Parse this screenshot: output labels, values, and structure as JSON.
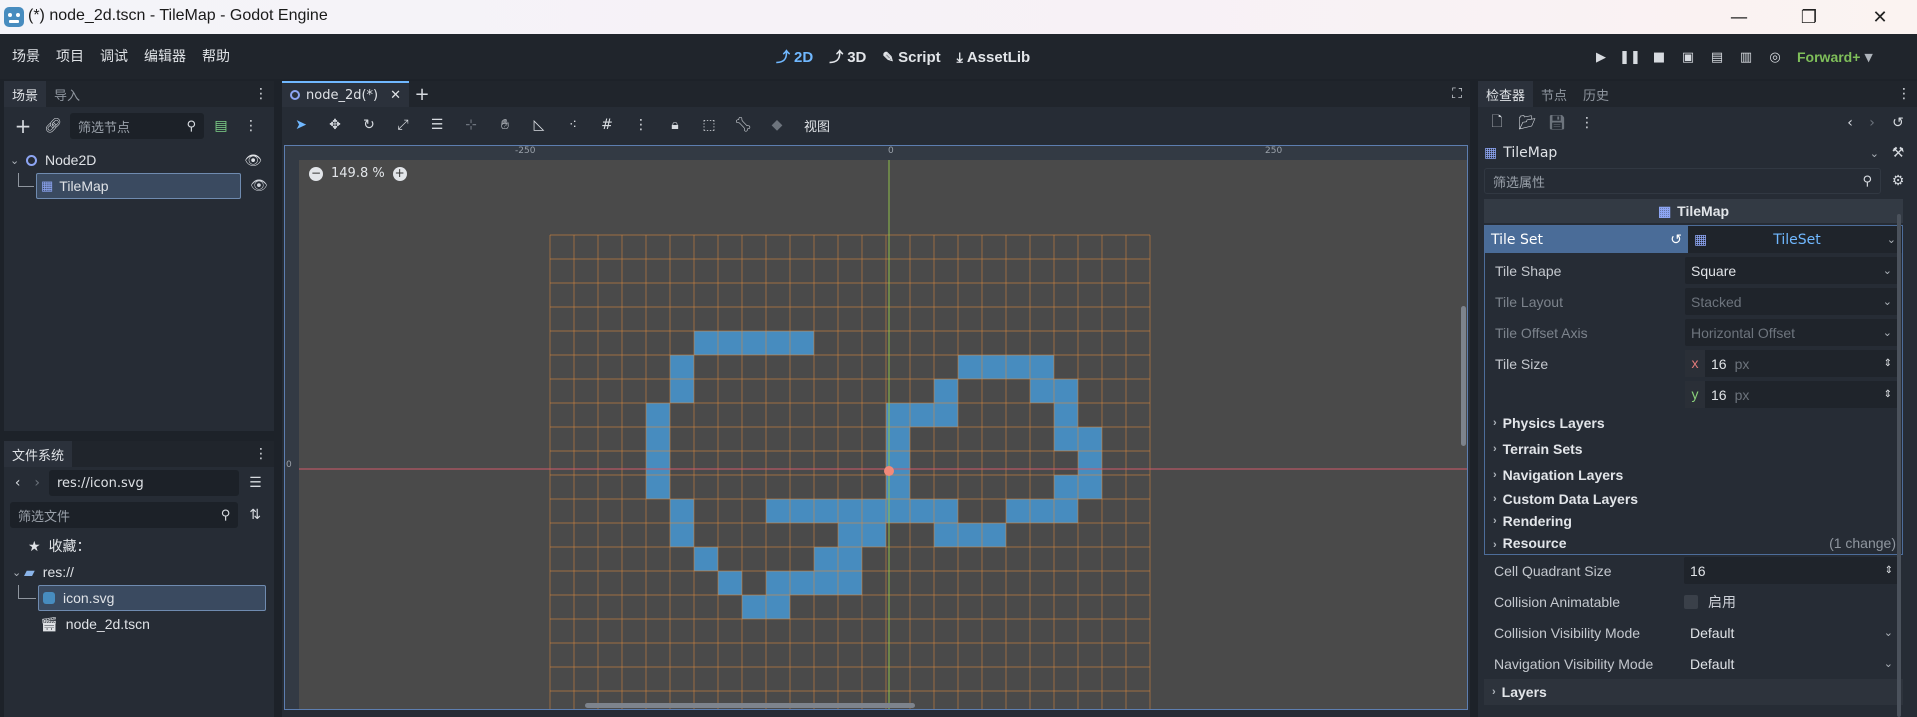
{
  "window": {
    "title": "(*) node_2d.tscn - TileMap - Godot Engine",
    "minimize": "—",
    "maximize": "❐",
    "close": "✕"
  },
  "menu": [
    "场景",
    "项目",
    "调试",
    "编辑器",
    "帮助"
  ],
  "workspaces": [
    {
      "label": "2D",
      "icon": "2d-icon",
      "active": true
    },
    {
      "label": "3D",
      "icon": "3d-icon",
      "active": false
    },
    {
      "label": "Script",
      "icon": "script-icon",
      "active": false
    },
    {
      "label": "AssetLib",
      "icon": "assetlib-icon",
      "active": false
    }
  ],
  "renderer": "Forward+",
  "scene_dock": {
    "tabs": [
      "场景",
      "导入"
    ],
    "filter_placeholder": "筛选节点",
    "nodes": [
      {
        "name": "Node2D",
        "icon": "node2d-icon"
      },
      {
        "name": "TileMap",
        "icon": "tilemap-icon"
      }
    ]
  },
  "filesystem_dock": {
    "title": "文件系统",
    "path": "res://icon.svg",
    "filter_placeholder": "筛选文件",
    "favorites": "收藏：",
    "root": "res://",
    "files": [
      "icon.svg",
      "node_2d.tscn"
    ]
  },
  "editor": {
    "tab": "node_2d(*)",
    "view_menu": "视图",
    "zoom": "149.8 %",
    "ruler_labels": [
      "-250",
      "0",
      "250"
    ],
    "ruler_v_label": "0"
  },
  "inspector": {
    "tabs": [
      "检查器",
      "节点",
      "历史"
    ],
    "object": "TileMap",
    "filter_placeholder": "筛选属性",
    "header": "TileMap",
    "tileset_label": "Tile Set",
    "tileset_value": "TileSet",
    "tile_shape": {
      "label": "Tile Shape",
      "value": "Square"
    },
    "tile_layout": {
      "label": "Tile Layout",
      "value": "Stacked"
    },
    "tile_offset_axis": {
      "label": "Tile Offset Axis",
      "value": "Horizontal Offset"
    },
    "tile_size": {
      "label": "Tile Size",
      "x": "16",
      "y": "16",
      "unit": "px",
      "x_label": "x",
      "y_label": "y"
    },
    "sections": [
      "Physics Layers",
      "Terrain Sets",
      "Navigation Layers",
      "Custom Data Layers",
      "Rendering",
      "Resource"
    ],
    "resource_note": "(1 change)",
    "cell_quadrant": {
      "label": "Cell Quadrant Size",
      "value": "16"
    },
    "collision_animatable": {
      "label": "Collision Animatable",
      "value": "启用"
    },
    "collision_visibility": {
      "label": "Collision Visibility Mode",
      "value": "Default"
    },
    "navigation_visibility": {
      "label": "Navigation Visibility Mode",
      "value": "Default"
    },
    "layers": "Layers"
  },
  "colors": {
    "accent": "#70b8ff",
    "tile": "#478cbf",
    "grid": "#e08a3c",
    "renderer": "#7fbf5a"
  }
}
